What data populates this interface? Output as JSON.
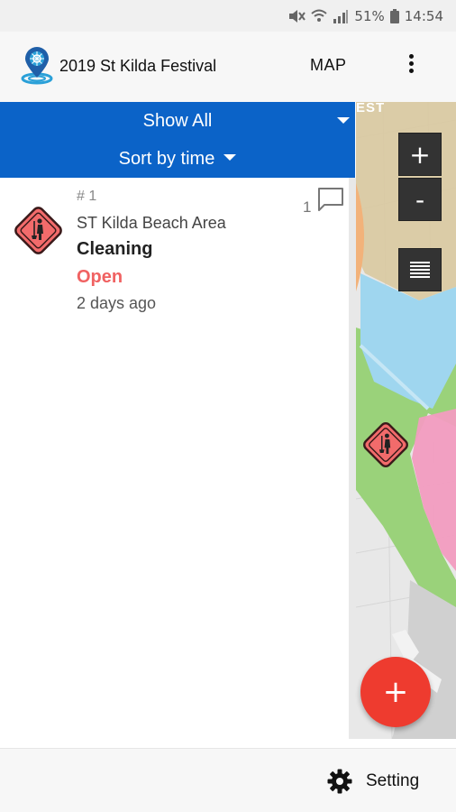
{
  "status_bar": {
    "battery": "51%",
    "time": "14:54"
  },
  "app_bar": {
    "title": "2019 St Kilda Festival",
    "map_label": "MAP"
  },
  "filter": {
    "show_all_label": "Show All",
    "sort_label": "Sort by time"
  },
  "issues": [
    {
      "number": "# 1",
      "location": "ST Kilda Beach Area",
      "category": "Cleaning",
      "status": "Open",
      "time_ago": "2 days ago",
      "comment_count": "1",
      "icon": "cleaning-warning-icon"
    }
  ],
  "map": {
    "label": "EST",
    "zoom_in": "+",
    "zoom_out": "-"
  },
  "fab": {
    "label": "+"
  },
  "bottom_bar": {
    "settings_label": "Setting"
  },
  "colors": {
    "accent_blue": "#0b63c8",
    "status_open": "#f06262",
    "fab_red": "#ee3b2f",
    "issue_icon": "#f26b6b"
  }
}
